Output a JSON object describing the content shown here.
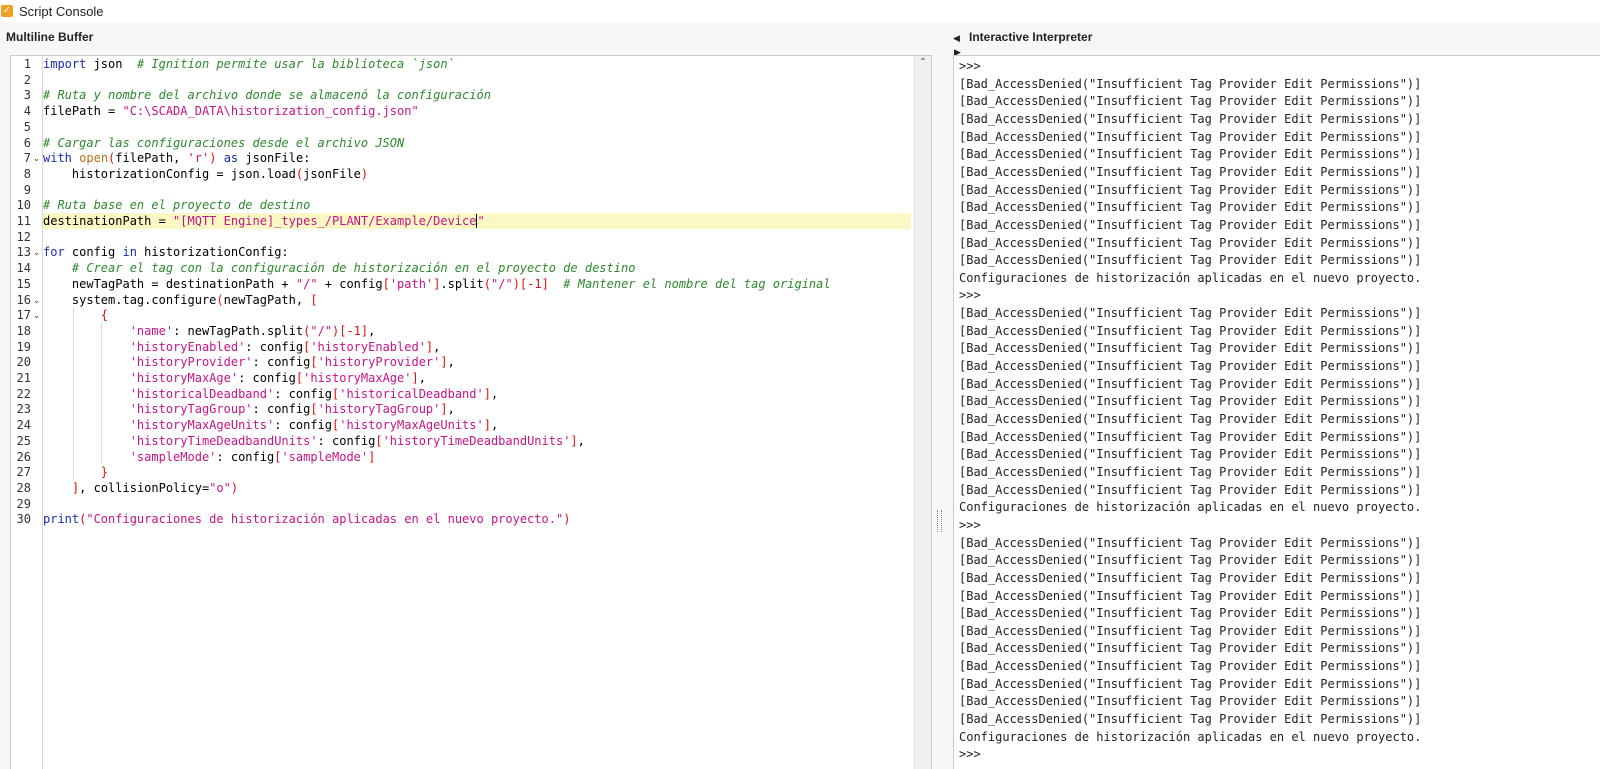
{
  "window": {
    "title": "Script Console"
  },
  "panes": {
    "left_title": "Multiline Buffer",
    "right_title": "Interactive Interpreter"
  },
  "editor": {
    "highlighted_line": 11,
    "lines": [
      [
        {
          "t": "k",
          "v": "import"
        },
        {
          "t": "",
          "v": " json  "
        },
        {
          "t": "c",
          "v": "# Ignition permite usar la biblioteca `json`"
        }
      ],
      [],
      [
        {
          "t": "c",
          "v": "# Ruta y nombre del archivo donde se almacenó la configuración"
        }
      ],
      [
        {
          "t": "",
          "v": "filePath = "
        },
        {
          "t": "s",
          "v": "\"C:\\SCADA_DATA\\historization_config.json\""
        }
      ],
      [],
      [
        {
          "t": "c",
          "v": "# Cargar las configuraciones desde el archivo JSON"
        }
      ],
      [
        {
          "t": "k",
          "v": "with"
        },
        {
          "t": "",
          "v": " "
        },
        {
          "t": "b",
          "v": "open"
        },
        {
          "t": "p",
          "v": "("
        },
        {
          "t": "",
          "v": "filePath, "
        },
        {
          "t": "s",
          "v": "'r'"
        },
        {
          "t": "p",
          "v": ")"
        },
        {
          "t": "",
          "v": " "
        },
        {
          "t": "k",
          "v": "as"
        },
        {
          "t": "",
          "v": " jsonFile:"
        }
      ],
      [
        {
          "t": "",
          "v": "    historizationConfig = json.load"
        },
        {
          "t": "p",
          "v": "("
        },
        {
          "t": "",
          "v": "jsonFile"
        },
        {
          "t": "p",
          "v": ")"
        }
      ],
      [],
      [
        {
          "t": "c",
          "v": "# Ruta base en el proyecto de destino"
        }
      ],
      [
        {
          "t": "",
          "v": "destinationPath = "
        },
        {
          "t": "s",
          "v": "\"[MQTT Engine]_types_/PLANT/Example/Device"
        },
        {
          "t": "caret",
          "v": ""
        },
        {
          "t": "s",
          "v": "\""
        }
      ],
      [],
      [
        {
          "t": "k",
          "v": "for"
        },
        {
          "t": "",
          "v": " config "
        },
        {
          "t": "k",
          "v": "in"
        },
        {
          "t": "",
          "v": " historizationConfig:"
        }
      ],
      [
        {
          "t": "",
          "v": "    "
        },
        {
          "t": "c",
          "v": "# Crear el tag con la configuración de historización en el proyecto de destino"
        }
      ],
      [
        {
          "t": "",
          "v": "    newTagPath = destinationPath + "
        },
        {
          "t": "s",
          "v": "\"/\""
        },
        {
          "t": "",
          "v": " + config"
        },
        {
          "t": "p",
          "v": "["
        },
        {
          "t": "s",
          "v": "'path'"
        },
        {
          "t": "p",
          "v": "]"
        },
        {
          "t": "",
          "v": ".split"
        },
        {
          "t": "p",
          "v": "("
        },
        {
          "t": "s",
          "v": "\"/\""
        },
        {
          "t": "p",
          "v": ")[-1]"
        },
        {
          "t": "",
          "v": "  "
        },
        {
          "t": "c",
          "v": "# Mantener el nombre del tag original"
        }
      ],
      [
        {
          "t": "",
          "v": "    system.tag.configure"
        },
        {
          "t": "p",
          "v": "("
        },
        {
          "t": "",
          "v": "newTagPath, "
        },
        {
          "t": "p",
          "v": "["
        }
      ],
      [
        {
          "t": "",
          "v": "        "
        },
        {
          "t": "p",
          "v": "{"
        }
      ],
      [
        {
          "t": "",
          "v": "            "
        },
        {
          "t": "s",
          "v": "'name'"
        },
        {
          "t": "",
          "v": ": newTagPath.split"
        },
        {
          "t": "p",
          "v": "("
        },
        {
          "t": "s",
          "v": "\"/\""
        },
        {
          "t": "p",
          "v": ")[-1]"
        },
        {
          "t": "",
          "v": ","
        }
      ],
      [
        {
          "t": "",
          "v": "            "
        },
        {
          "t": "s",
          "v": "'historyEnabled'"
        },
        {
          "t": "",
          "v": ": config"
        },
        {
          "t": "p",
          "v": "["
        },
        {
          "t": "s",
          "v": "'historyEnabled'"
        },
        {
          "t": "p",
          "v": "]"
        },
        {
          "t": "",
          "v": ","
        }
      ],
      [
        {
          "t": "",
          "v": "            "
        },
        {
          "t": "s",
          "v": "'historyProvider'"
        },
        {
          "t": "",
          "v": ": config"
        },
        {
          "t": "p",
          "v": "["
        },
        {
          "t": "s",
          "v": "'historyProvider'"
        },
        {
          "t": "p",
          "v": "]"
        },
        {
          "t": "",
          "v": ","
        }
      ],
      [
        {
          "t": "",
          "v": "            "
        },
        {
          "t": "s",
          "v": "'historyMaxAge'"
        },
        {
          "t": "",
          "v": ": config"
        },
        {
          "t": "p",
          "v": "["
        },
        {
          "t": "s",
          "v": "'historyMaxAge'"
        },
        {
          "t": "p",
          "v": "]"
        },
        {
          "t": "",
          "v": ","
        }
      ],
      [
        {
          "t": "",
          "v": "            "
        },
        {
          "t": "s",
          "v": "'historicalDeadband'"
        },
        {
          "t": "",
          "v": ": config"
        },
        {
          "t": "p",
          "v": "["
        },
        {
          "t": "s",
          "v": "'historicalDeadband'"
        },
        {
          "t": "p",
          "v": "]"
        },
        {
          "t": "",
          "v": ","
        }
      ],
      [
        {
          "t": "",
          "v": "            "
        },
        {
          "t": "s",
          "v": "'historyTagGroup'"
        },
        {
          "t": "",
          "v": ": config"
        },
        {
          "t": "p",
          "v": "["
        },
        {
          "t": "s",
          "v": "'historyTagGroup'"
        },
        {
          "t": "p",
          "v": "]"
        },
        {
          "t": "",
          "v": ","
        }
      ],
      [
        {
          "t": "",
          "v": "            "
        },
        {
          "t": "s",
          "v": "'historyMaxAgeUnits'"
        },
        {
          "t": "",
          "v": ": config"
        },
        {
          "t": "p",
          "v": "["
        },
        {
          "t": "s",
          "v": "'historyMaxAgeUnits'"
        },
        {
          "t": "p",
          "v": "]"
        },
        {
          "t": "",
          "v": ","
        }
      ],
      [
        {
          "t": "",
          "v": "            "
        },
        {
          "t": "s",
          "v": "'historyTimeDeadbandUnits'"
        },
        {
          "t": "",
          "v": ": config"
        },
        {
          "t": "p",
          "v": "["
        },
        {
          "t": "s",
          "v": "'historyTimeDeadbandUnits'"
        },
        {
          "t": "p",
          "v": "]"
        },
        {
          "t": "",
          "v": ","
        }
      ],
      [
        {
          "t": "",
          "v": "            "
        },
        {
          "t": "s",
          "v": "'sampleMode'"
        },
        {
          "t": "",
          "v": ": config"
        },
        {
          "t": "p",
          "v": "["
        },
        {
          "t": "s",
          "v": "'sampleMode'"
        },
        {
          "t": "p",
          "v": "]"
        }
      ],
      [
        {
          "t": "",
          "v": "        "
        },
        {
          "t": "p",
          "v": "}"
        }
      ],
      [
        {
          "t": "",
          "v": "    "
        },
        {
          "t": "p",
          "v": "]"
        },
        {
          "t": "",
          "v": ", collisionPolicy="
        },
        {
          "t": "s",
          "v": "\"o\""
        },
        {
          "t": "p",
          "v": ")"
        }
      ],
      [],
      [
        {
          "t": "k",
          "v": "print"
        },
        {
          "t": "p",
          "v": "("
        },
        {
          "t": "s",
          "v": "\"Configuraciones de historización aplicadas en el nuevo proyecto.\""
        },
        {
          "t": "p",
          "v": ")"
        }
      ]
    ],
    "fold_lines": [
      7,
      13,
      16,
      17
    ]
  },
  "interpreter": {
    "lines": [
      ">>>",
      "[Bad_AccessDenied(\"Insufficient Tag Provider Edit Permissions\")]",
      "[Bad_AccessDenied(\"Insufficient Tag Provider Edit Permissions\")]",
      "[Bad_AccessDenied(\"Insufficient Tag Provider Edit Permissions\")]",
      "[Bad_AccessDenied(\"Insufficient Tag Provider Edit Permissions\")]",
      "[Bad_AccessDenied(\"Insufficient Tag Provider Edit Permissions\")]",
      "[Bad_AccessDenied(\"Insufficient Tag Provider Edit Permissions\")]",
      "[Bad_AccessDenied(\"Insufficient Tag Provider Edit Permissions\")]",
      "[Bad_AccessDenied(\"Insufficient Tag Provider Edit Permissions\")]",
      "[Bad_AccessDenied(\"Insufficient Tag Provider Edit Permissions\")]",
      "[Bad_AccessDenied(\"Insufficient Tag Provider Edit Permissions\")]",
      "[Bad_AccessDenied(\"Insufficient Tag Provider Edit Permissions\")]",
      "Configuraciones de historización aplicadas en el nuevo proyecto.",
      ">>>",
      "[Bad_AccessDenied(\"Insufficient Tag Provider Edit Permissions\")]",
      "[Bad_AccessDenied(\"Insufficient Tag Provider Edit Permissions\")]",
      "[Bad_AccessDenied(\"Insufficient Tag Provider Edit Permissions\")]",
      "[Bad_AccessDenied(\"Insufficient Tag Provider Edit Permissions\")]",
      "[Bad_AccessDenied(\"Insufficient Tag Provider Edit Permissions\")]",
      "[Bad_AccessDenied(\"Insufficient Tag Provider Edit Permissions\")]",
      "[Bad_AccessDenied(\"Insufficient Tag Provider Edit Permissions\")]",
      "[Bad_AccessDenied(\"Insufficient Tag Provider Edit Permissions\")]",
      "[Bad_AccessDenied(\"Insufficient Tag Provider Edit Permissions\")]",
      "[Bad_AccessDenied(\"Insufficient Tag Provider Edit Permissions\")]",
      "[Bad_AccessDenied(\"Insufficient Tag Provider Edit Permissions\")]",
      "Configuraciones de historización aplicadas en el nuevo proyecto.",
      ">>>",
      "[Bad_AccessDenied(\"Insufficient Tag Provider Edit Permissions\")]",
      "[Bad_AccessDenied(\"Insufficient Tag Provider Edit Permissions\")]",
      "[Bad_AccessDenied(\"Insufficient Tag Provider Edit Permissions\")]",
      "[Bad_AccessDenied(\"Insufficient Tag Provider Edit Permissions\")]",
      "[Bad_AccessDenied(\"Insufficient Tag Provider Edit Permissions\")]",
      "[Bad_AccessDenied(\"Insufficient Tag Provider Edit Permissions\")]",
      "[Bad_AccessDenied(\"Insufficient Tag Provider Edit Permissions\")]",
      "[Bad_AccessDenied(\"Insufficient Tag Provider Edit Permissions\")]",
      "[Bad_AccessDenied(\"Insufficient Tag Provider Edit Permissions\")]",
      "[Bad_AccessDenied(\"Insufficient Tag Provider Edit Permissions\")]",
      "[Bad_AccessDenied(\"Insufficient Tag Provider Edit Permissions\")]",
      "Configuraciones de historización aplicadas en el nuevo proyecto.",
      ">>>"
    ]
  },
  "icons": {
    "app": "app-icon",
    "collapse_left": "triangle-left-icon",
    "expand_right": "triangle-right-icon",
    "scroll_up": "chevron-up-icon",
    "fold": "fold-chevron-icon"
  },
  "colors": {
    "keyword": "#1b2bb0",
    "comment": "#2d8a2d",
    "string": "#c41489",
    "builtin": "#b7701a",
    "bracket": "#dd1111",
    "highlight": "#fcf8c4"
  }
}
